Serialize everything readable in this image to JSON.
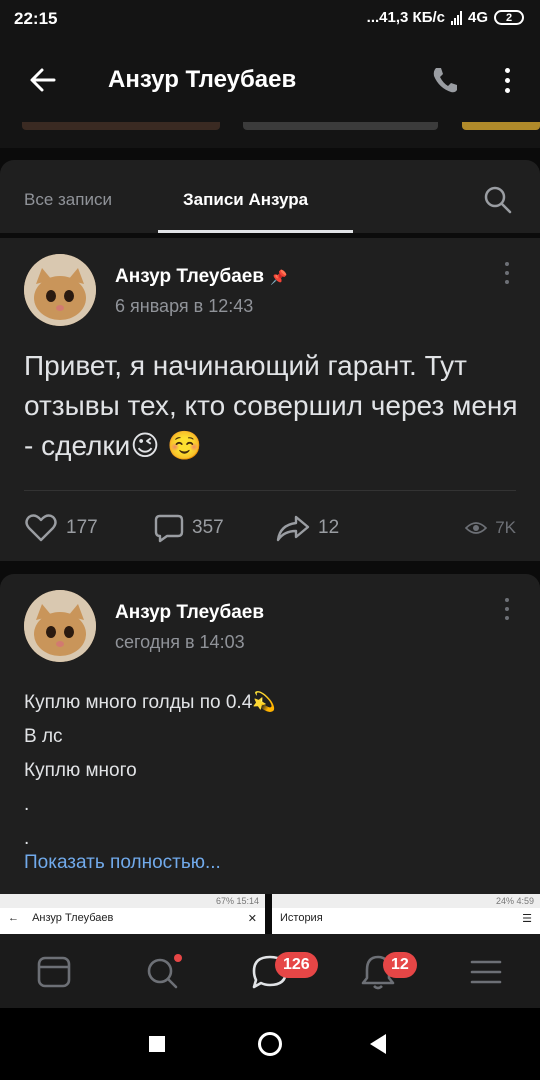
{
  "status_bar": {
    "time": "22:15",
    "speed": "...41,3 КБ/с",
    "network": "4G",
    "battery": "2"
  },
  "header": {
    "title": "Анзур Тлеубаев"
  },
  "tabs": {
    "all": "Все записи",
    "own": "Записи Анзура"
  },
  "post1": {
    "author": "Анзур Тлеубаев",
    "date": "6 января в 12:43",
    "text": "Привет, я начинающий гарант. Тут отзывы тех, кто совершил через меня - сделки😉 ☺️",
    "likes": "177",
    "comments": "357",
    "shares": "12",
    "views": "7K"
  },
  "post2": {
    "author": "Анзур Тлеубаев",
    "date": "сегодня в 14:03",
    "lines": [
      "Куплю много голды по 0.4💫",
      "В лс",
      "Куплю много",
      ".",
      "."
    ],
    "show_more": "Показать полностью..."
  },
  "attachments": {
    "left_title": "Анзур Тлеубаев",
    "left_status": "67% 15:14",
    "right_title": "История",
    "right_status": "24% 4:59"
  },
  "bottom_nav": {
    "messages_badge": "126",
    "notifications_badge": "12"
  },
  "colors": {
    "background": "#0b0b0b",
    "card": "#1f1f1f",
    "link": "#71aaeb",
    "badge": "#e64646"
  }
}
